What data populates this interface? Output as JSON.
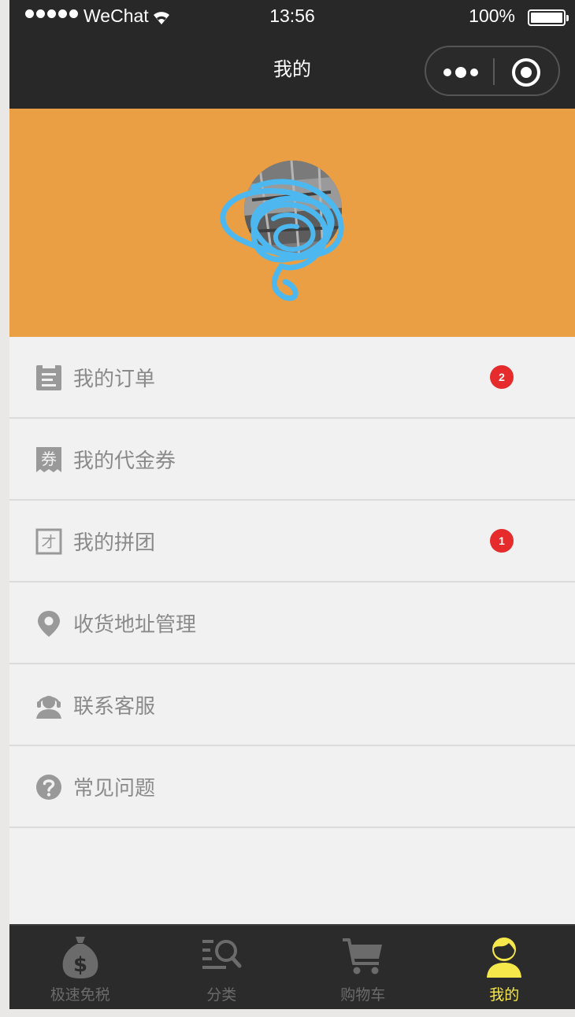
{
  "status_bar": {
    "carrier": "WeChat",
    "time": "13:56",
    "battery": "100%"
  },
  "nav": {
    "title": "我的"
  },
  "menu": {
    "items": [
      {
        "label": "我的订单",
        "icon": "order-list-icon",
        "badge": "2"
      },
      {
        "label": "我的代金券",
        "icon": "voucher-icon",
        "badge": null
      },
      {
        "label": "我的拼团",
        "icon": "group-buy-icon",
        "badge": "1"
      },
      {
        "label": "收货地址管理",
        "icon": "location-pin-icon",
        "badge": null
      },
      {
        "label": "联系客服",
        "icon": "customer-service-icon",
        "badge": null
      },
      {
        "label": "常见问题",
        "icon": "question-icon",
        "badge": null
      }
    ]
  },
  "tabbar": {
    "items": [
      {
        "label": "极速免税",
        "icon": "money-bag-icon",
        "active": false
      },
      {
        "label": "分类",
        "icon": "category-search-icon",
        "active": false
      },
      {
        "label": "购物车",
        "icon": "shopping-cart-icon",
        "active": false
      },
      {
        "label": "我的",
        "icon": "user-profile-icon",
        "active": true
      }
    ]
  },
  "colors": {
    "bar_background": "#282828",
    "banner": "#eb9f44",
    "badge": "#e52b2b",
    "active_tab": "#f6e84a",
    "inactive_tab": "#6b6b6b"
  }
}
